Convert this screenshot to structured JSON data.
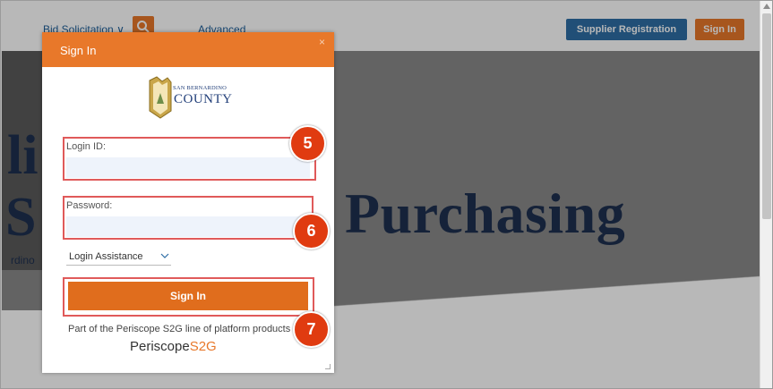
{
  "topbar": {
    "bid_solicitation": "Bid Solicitation",
    "bid_chevron": "∨",
    "advanced": "Advanced",
    "supplier_registration": "Supplier Registration",
    "sign_in": "Sign In"
  },
  "hero": {
    "fragment_1": "li",
    "fragment_2": "S",
    "fragment_3": "rdino",
    "title": "Purchasing"
  },
  "modal": {
    "title": "Sign In",
    "close_icon": "×",
    "logo": {
      "line1": "SAN BERNARDINO",
      "line2": "COUNTY"
    },
    "login_label": "Login ID:",
    "login_value": "",
    "password_label": "Password:",
    "password_value": "",
    "login_assistance": "Login Assistance",
    "sign_in_button": "Sign In",
    "footer": "Part of the Periscope S2G line of platform products",
    "brand_main": "Periscope",
    "brand_accent": "S2G"
  },
  "callouts": {
    "step_5": "5",
    "step_6": "6",
    "step_7": "7"
  },
  "colors": {
    "accent_orange": "#e8782a",
    "supplier_blue": "#2e6ea5",
    "callout_red": "#e03b10",
    "highlight_border": "#e05a5a"
  },
  "icons": {
    "search": "search-icon",
    "close": "close-icon",
    "chevron": "chevron-down-icon",
    "logo": "county-badge-logo"
  }
}
